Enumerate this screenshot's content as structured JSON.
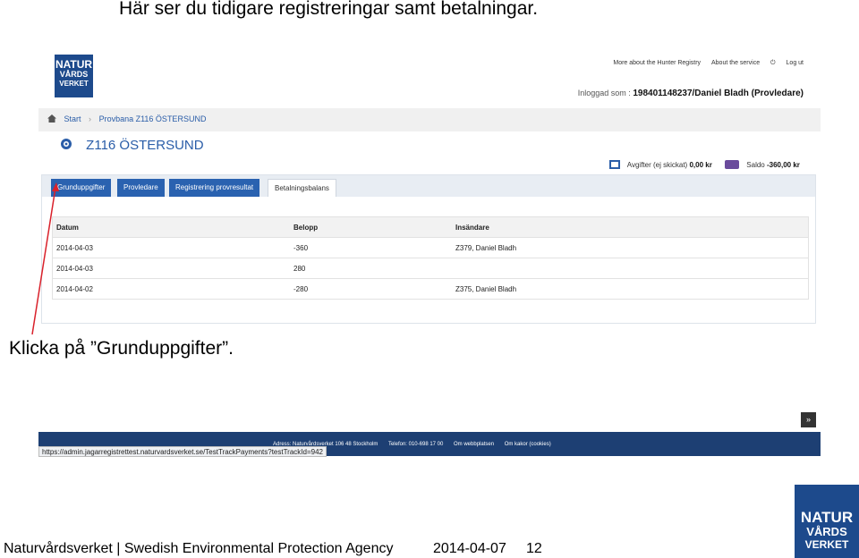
{
  "slide": {
    "heading": "Här ser du tidigare registreringar samt betalningar.",
    "callout": "Klicka på ”Grunduppgifter”.",
    "footer_text": "Naturvårdsverket | Swedish Environmental Protection Agency",
    "footer_date": "2014-04-07",
    "page_number": "12",
    "logo": {
      "line1": "NATUR",
      "line2": "VÅRDS",
      "line3": "VERKET"
    }
  },
  "screenshot": {
    "top_links": [
      "More about the Hunter Registry",
      "About the service",
      "Log ut"
    ],
    "login_label": "Inloggad som :",
    "login_user": "198401148237/Daniel Bladh (Provledare)",
    "breadcrumb": [
      "Start",
      "Provbana Z116 ÖSTERSUND"
    ],
    "unit_title": "Z116 ÖSTERSUND",
    "fees_label": "Avgifter (ej skickat)",
    "fees_value": "0,00 kr",
    "balance_label": "Saldo",
    "balance_value": "-360,00 kr",
    "tabs": [
      "Grunduppgifter",
      "Provledare",
      "Registrering provresultat",
      "Betalningsbalans"
    ],
    "table": {
      "columns": [
        "Datum",
        "Belopp",
        "Insändare"
      ],
      "rows": [
        [
          "2014-04-03",
          "-360",
          "Z379, Daniel Bladh"
        ],
        [
          "2014-04-03",
          "280",
          ""
        ],
        [
          "2014-04-02",
          "-280",
          "Z375, Daniel Bladh"
        ]
      ]
    },
    "footer_address": [
      "Adress: Naturvårdsverket 106 48 Stockholm",
      "Telefon: 010-698 17 00",
      "Om webbplatsen",
      "Om kakor (cookies)"
    ],
    "status_url": "https://admin.jagarregistrettest.naturvardsverket.se/TestTrackPayments?testTrackId=942",
    "scroll_top_glyph": "»",
    "colors": {
      "brand": "#1d4a8c",
      "tab": "#2a62b0",
      "footer": "#1d3f73",
      "arrow": "#d9212b"
    }
  }
}
